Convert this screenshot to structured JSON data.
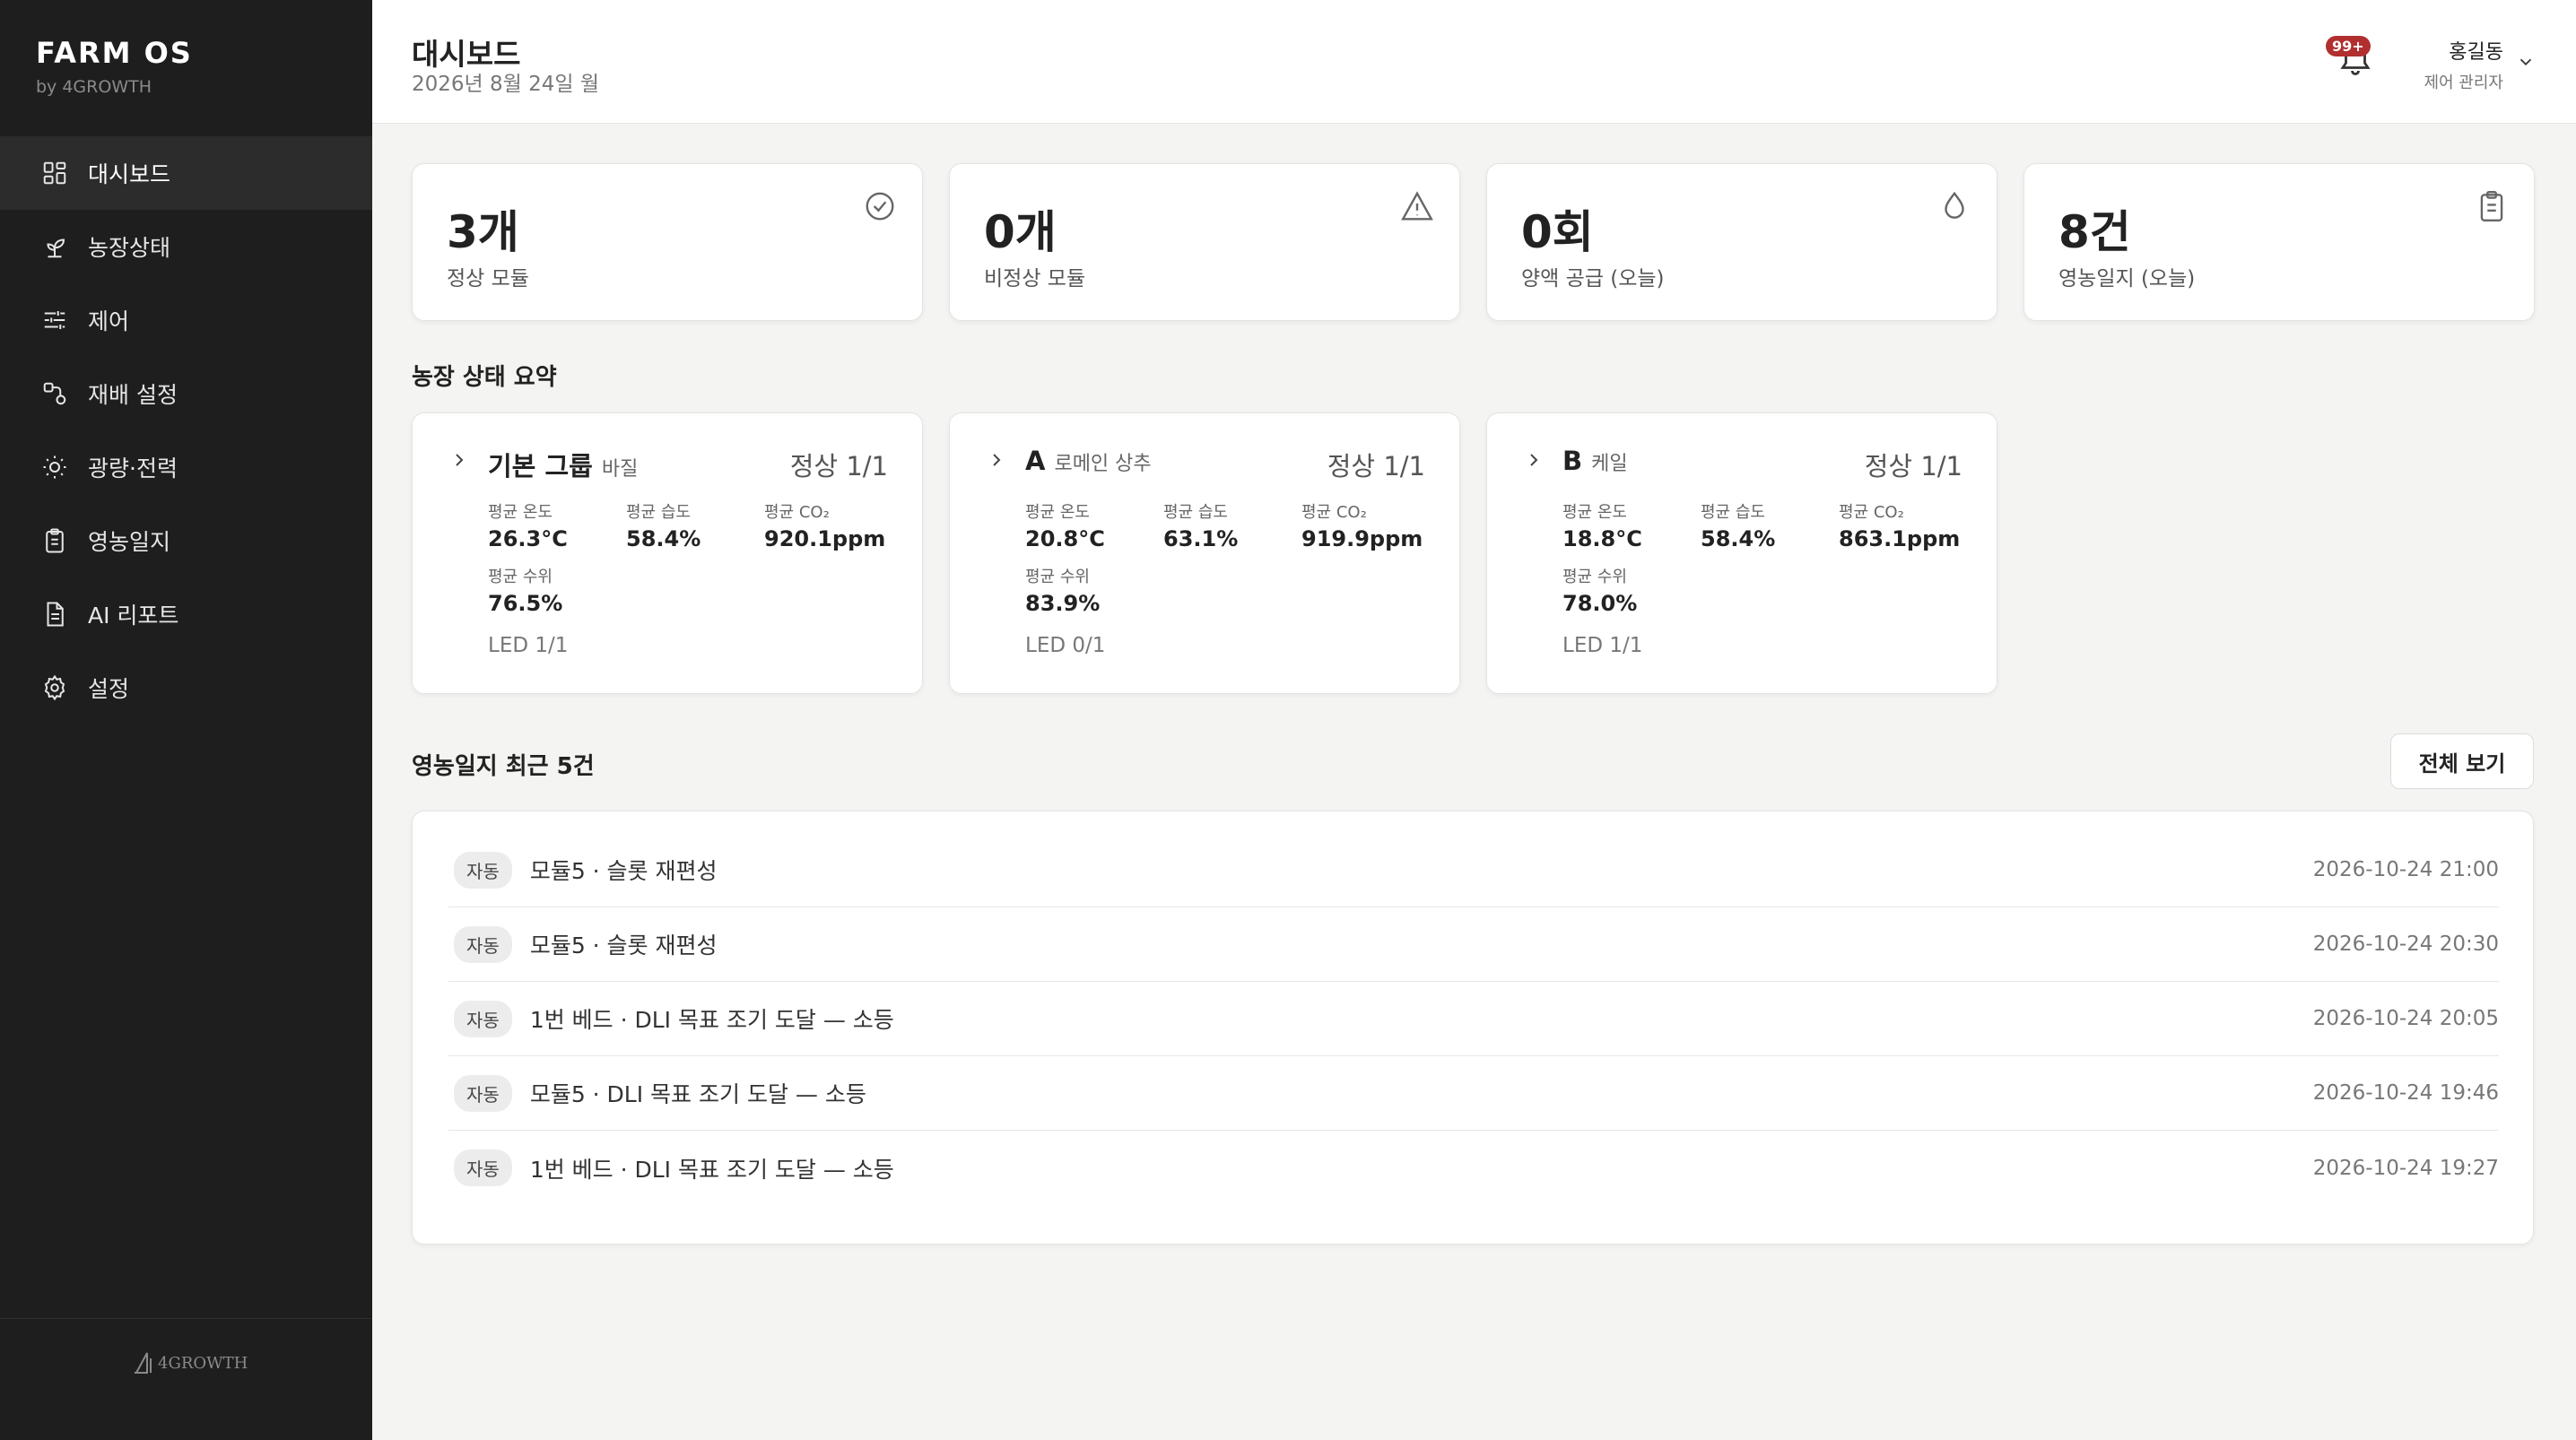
{
  "sidebar": {
    "brand_title": "FARM OS",
    "brand_sub": "by 4GROWTH",
    "items": [
      {
        "label": "대시보드",
        "icon": "dashboard-icon"
      },
      {
        "label": "농장상태",
        "icon": "sprout-icon"
      },
      {
        "label": "제어",
        "icon": "sliders-icon"
      },
      {
        "label": "재배 설정",
        "icon": "flow-icon"
      },
      {
        "label": "광량·전력",
        "icon": "sun-icon"
      },
      {
        "label": "영농일지",
        "icon": "clipboard-icon"
      },
      {
        "label": "AI 리포트",
        "icon": "document-icon"
      },
      {
        "label": "설정",
        "icon": "gear-icon"
      }
    ],
    "footer_logo": "4GROWTH"
  },
  "header": {
    "title": "대시보드",
    "date": "2026년 8월 24일 월",
    "badge": "99+",
    "user_name": "홍길동",
    "user_role": "제어 관리자"
  },
  "stats": [
    {
      "value": "3개",
      "label": "정상 모듈",
      "icon": "check-circle-icon"
    },
    {
      "value": "0개",
      "label": "비정상 모듈",
      "icon": "warning-icon"
    },
    {
      "value": "0회",
      "label": "양액 공급 (오늘)",
      "icon": "drop-icon"
    },
    {
      "value": "8건",
      "label": "영농일지 (오늘)",
      "icon": "clipboard-icon"
    }
  ],
  "farm_summary": {
    "title": "농장 상태 요약",
    "cards": [
      {
        "name": "기본 그룹",
        "crop": "바질",
        "status": "정상 1/1",
        "temp_label": "평균 온도",
        "temp": "26.3°C",
        "hum_label": "평균 습도",
        "hum": "58.4%",
        "co2_label": "평균 CO₂",
        "co2": "920.1ppm",
        "water_label": "평균 수위",
        "water": "76.5%",
        "led": "LED 1/1"
      },
      {
        "name": "A",
        "crop": "로메인 상추",
        "status": "정상 1/1",
        "temp_label": "평균 온도",
        "temp": "20.8°C",
        "hum_label": "평균 습도",
        "hum": "63.1%",
        "co2_label": "평균 CO₂",
        "co2": "919.9ppm",
        "water_label": "평균 수위",
        "water": "83.9%",
        "led": "LED 0/1"
      },
      {
        "name": "B",
        "crop": "케일",
        "status": "정상 1/1",
        "temp_label": "평균 온도",
        "temp": "18.8°C",
        "hum_label": "평균 습도",
        "hum": "58.4%",
        "co2_label": "평균 CO₂",
        "co2": "863.1ppm",
        "water_label": "평균 수위",
        "water": "78.0%",
        "led": "LED 1/1"
      }
    ]
  },
  "journal": {
    "title": "영농일지 최근 5건",
    "view_all": "전체 보기",
    "rows": [
      {
        "tag": "자동",
        "text": "모듈5 · 슬롯 재편성",
        "time": "2026-10-24 21:00"
      },
      {
        "tag": "자동",
        "text": "모듈5 · 슬롯 재편성",
        "time": "2026-10-24 20:30"
      },
      {
        "tag": "자동",
        "text": "1번 베드 · DLI 목표 조기 도달 — 소등",
        "time": "2026-10-24 20:05"
      },
      {
        "tag": "자동",
        "text": "모듈5 · DLI 목표 조기 도달 — 소등",
        "time": "2026-10-24 19:46"
      },
      {
        "tag": "자동",
        "text": "1번 베드 · DLI 목표 조기 도달 — 소등",
        "time": "2026-10-24 19:27"
      }
    ]
  },
  "colors": {
    "sidebar_bg": "#1e1e1e",
    "page_bg": "#f4f4f2",
    "badge": "#b12f2f"
  }
}
